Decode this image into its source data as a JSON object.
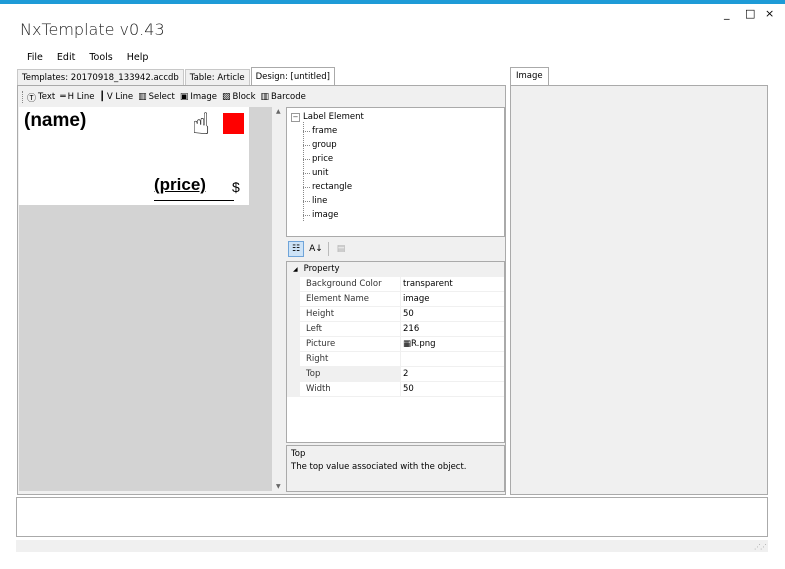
{
  "window": {
    "title": "NxTemplate v0.43",
    "controls": {
      "minimize": "_",
      "maximize": "□",
      "close": "×"
    }
  },
  "menu": [
    "File",
    "Edit",
    "Tools",
    "Help"
  ],
  "tabs": [
    {
      "label": "Templates: 20170918_133942.accdb"
    },
    {
      "label": "Table: Article"
    },
    {
      "label": "Design: [untitled]",
      "active": true
    }
  ],
  "toolbar": {
    "items": [
      {
        "label": "Text",
        "icon": "text-tool-icon",
        "glyph": "Ⓣ"
      },
      {
        "label": "H Line",
        "icon": "hline-tool-icon",
        "glyph": "═"
      },
      {
        "label": "V Line",
        "icon": "vline-tool-icon",
        "glyph": "┃"
      },
      {
        "label": "Select",
        "icon": "select-tool-icon",
        "glyph": "▥"
      },
      {
        "label": "Image",
        "icon": "image-tool-icon",
        "glyph": "▣"
      },
      {
        "label": "Block",
        "icon": "block-tool-icon",
        "glyph": "▨"
      },
      {
        "label": "Barcode",
        "icon": "barcode-tool-icon",
        "glyph": "▥"
      }
    ]
  },
  "label": {
    "name_text": "(name)",
    "price_text": "(price)",
    "unit_text": "$",
    "image_glyph": "☝",
    "rect_color": "#ff0000"
  },
  "tree": {
    "root": "Label Element",
    "expander": "⊟",
    "children": [
      "frame",
      "group",
      "price",
      "unit",
      "rectangle",
      "line",
      "image"
    ]
  },
  "propertygrid": {
    "toolbar": {
      "categorized": "☷",
      "alphabetical": "A↓",
      "pages": "▤"
    },
    "category": "Property",
    "rows": [
      {
        "name": "Background Color",
        "value": "transparent"
      },
      {
        "name": "Element Name",
        "value": "image"
      },
      {
        "name": "Height",
        "value": "50"
      },
      {
        "name": "Left",
        "value": "216"
      },
      {
        "name": "Picture",
        "value": "R.png"
      },
      {
        "name": "Right",
        "value": ""
      },
      {
        "name": "Top",
        "value": "2"
      },
      {
        "name": "Width",
        "value": "50"
      }
    ],
    "description": {
      "title": "Top",
      "text": "The top value associated with the object."
    }
  },
  "rightpanel": {
    "tab": "Image"
  },
  "colors": {
    "accent": "#1e9bd7",
    "panel": "#f0f0f0",
    "canvas_bg": "#d3d3d3"
  }
}
